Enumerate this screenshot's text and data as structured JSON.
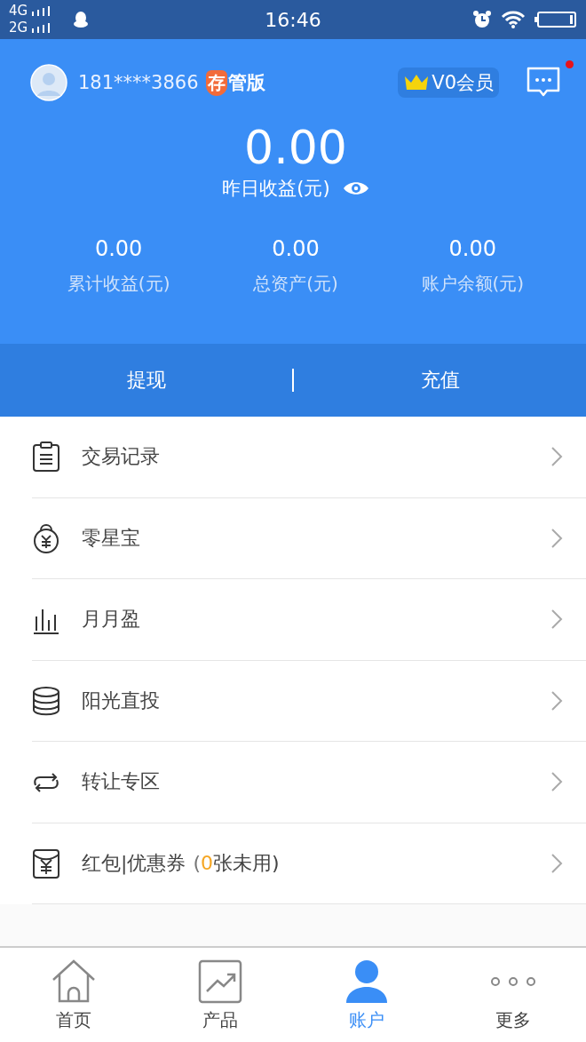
{
  "status_bar": {
    "networks": [
      "4G",
      "2G"
    ],
    "time": "16:46"
  },
  "header": {
    "phone": "181****3866",
    "badge_char": "存",
    "badge_text": "管版",
    "member": "V0会员",
    "unread": true,
    "yesterday_value": "0.00",
    "yesterday_label": "昨日收益(元)",
    "stats": [
      {
        "value": "0.00",
        "label": "累计收益(元)"
      },
      {
        "value": "0.00",
        "label": "总资产(元)"
      },
      {
        "value": "0.00",
        "label": "账户余额(元)"
      }
    ]
  },
  "actions": [
    "提现",
    "充值"
  ],
  "menu": [
    {
      "label": "交易记录"
    },
    {
      "label": "零星宝"
    },
    {
      "label": "月月盈"
    },
    {
      "label": "阳光直投"
    },
    {
      "label": "转让专区"
    },
    {
      "label": "红包|优惠券",
      "note_open": "(",
      "count": "0",
      "note_close": "张未用)"
    }
  ],
  "tab_bar": [
    {
      "label": "首页",
      "selected": false
    },
    {
      "label": "产品",
      "selected": false
    },
    {
      "label": "账户",
      "selected": true
    },
    {
      "label": "更多",
      "selected": false
    }
  ]
}
